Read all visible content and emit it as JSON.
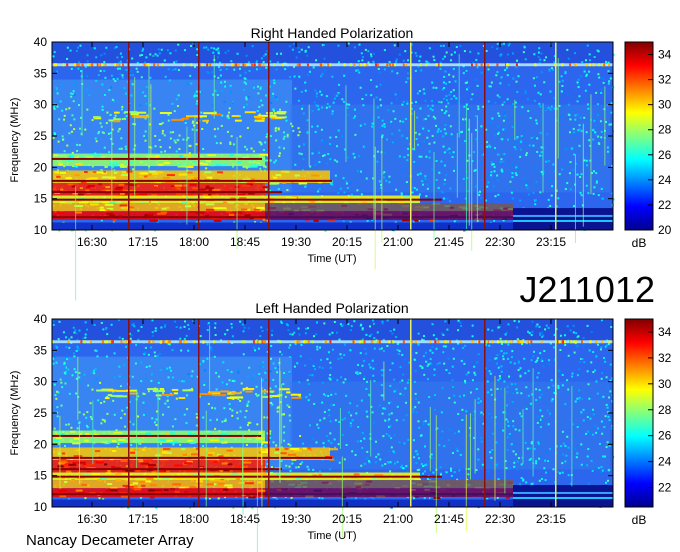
{
  "source_label": "Nancay Decameter Array",
  "date_label": "J211012",
  "chart_data": [
    {
      "type": "heatmap",
      "title": "Right Handed Polarization",
      "xlabel": "Time (UT)",
      "ylabel": "Frequency (MHz)",
      "x_ticks": [
        "16:30",
        "17:15",
        "18:00",
        "18:45",
        "19:30",
        "20:15",
        "21:00",
        "21:45",
        "22:30",
        "23:15"
      ],
      "y_ticks": [
        10,
        15,
        20,
        25,
        30,
        35,
        40
      ],
      "ylim": [
        10,
        40
      ],
      "colorbar": {
        "label": "dB",
        "ticks": [
          20,
          22,
          24,
          26,
          28,
          30,
          32,
          34
        ],
        "range": [
          20,
          35
        ]
      }
    },
    {
      "type": "heatmap",
      "title": "Left Handed Polarization",
      "xlabel": "Time (UT)",
      "ylabel": "Frequency (MHz)",
      "x_ticks": [
        "16:30",
        "17:15",
        "18:00",
        "18:45",
        "19:30",
        "20:15",
        "21:00",
        "21:45",
        "22:30",
        "23:15"
      ],
      "y_ticks": [
        10,
        15,
        20,
        25,
        30,
        35,
        40
      ],
      "ylim": [
        10,
        40
      ],
      "colorbar": {
        "label": "dB",
        "ticks": [
          22,
          24,
          26,
          28,
          30,
          32,
          34
        ],
        "range": [
          20.5,
          35
        ]
      }
    }
  ]
}
